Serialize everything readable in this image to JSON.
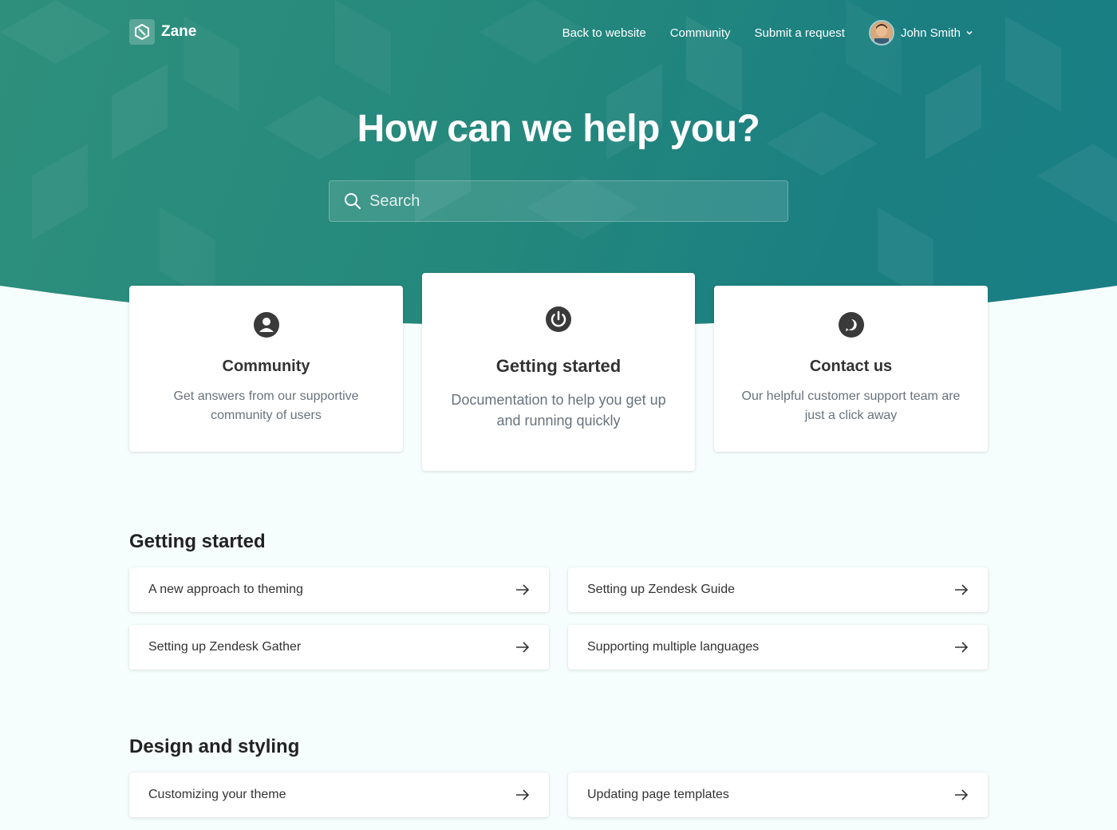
{
  "brand": {
    "name": "Zane"
  },
  "nav": {
    "back": "Back to website",
    "community": "Community",
    "submit": "Submit a request",
    "user": "John Smith"
  },
  "hero": {
    "title": "How can we help you?"
  },
  "search": {
    "placeholder": "Search"
  },
  "blocks": [
    {
      "title": "Community",
      "desc": "Get answers from our supportive community of users",
      "icon": "user-circle-icon"
    },
    {
      "title": "Getting started",
      "desc": "Documentation to help you get up and running quickly",
      "icon": "power-icon"
    },
    {
      "title": "Contact us",
      "desc": "Our helpful customer support team are just a click away",
      "icon": "chat-bubble-icon"
    }
  ],
  "sections": [
    {
      "title": "Getting started",
      "articles": [
        "A new approach to theming",
        "Setting up Zendesk Guide",
        "Setting up Zendesk Gather",
        "Supporting multiple languages"
      ]
    },
    {
      "title": "Design and styling",
      "articles": [
        "Customizing your theme",
        "Updating page templates"
      ]
    }
  ],
  "colors": {
    "brand": "#24887c",
    "background": "#f6fefd"
  }
}
